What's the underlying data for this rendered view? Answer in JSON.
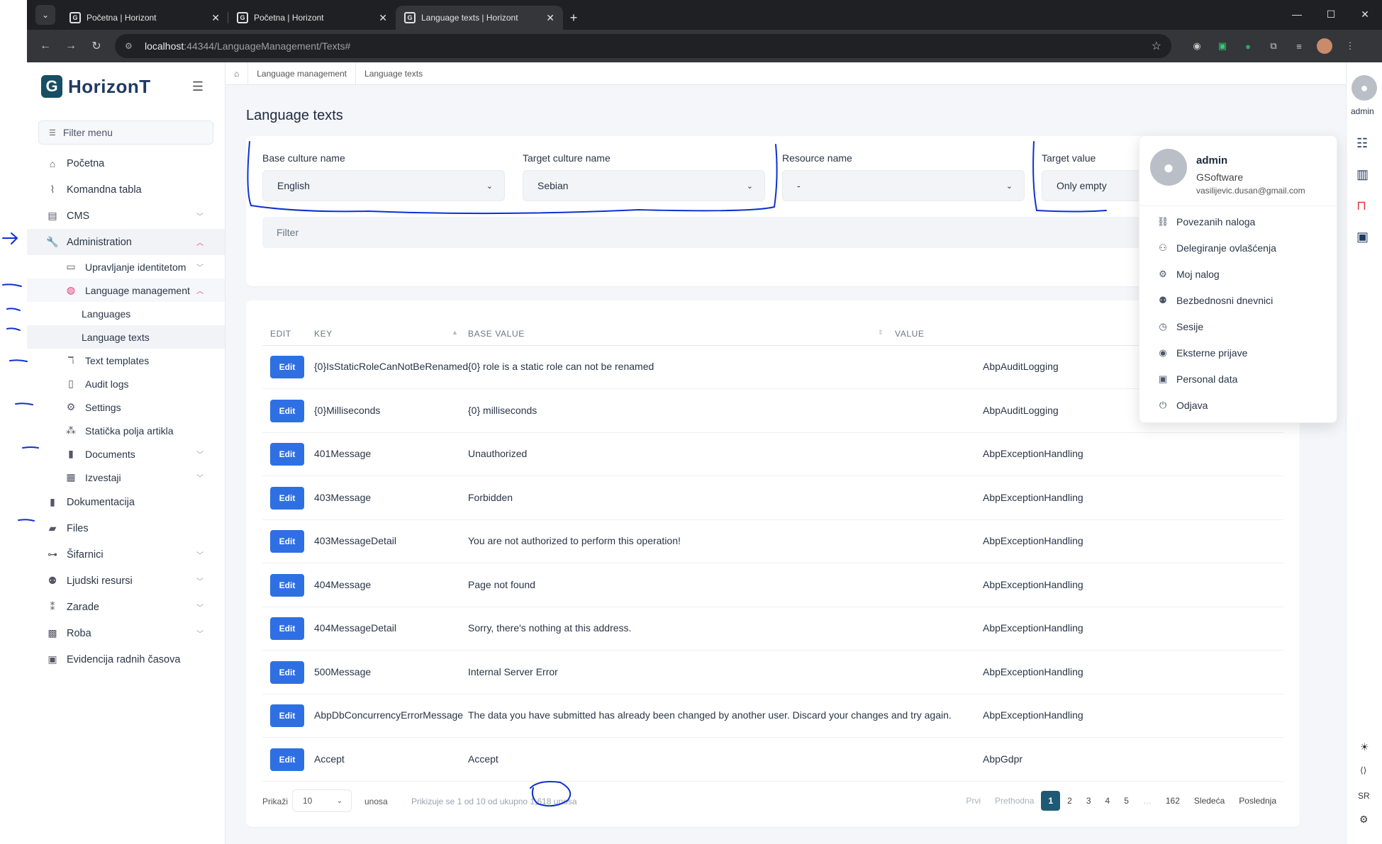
{
  "browser": {
    "tabs": [
      {
        "title": "Početna | Horizont",
        "active": false
      },
      {
        "title": "Početna | Horizont",
        "active": false
      },
      {
        "title": "Language texts | Horizont",
        "active": true
      }
    ],
    "url_host": "localhost",
    "url_path": ":44344/LanguageManagement/Texts#"
  },
  "app": {
    "logo_text": "HorizonT",
    "filter_menu_placeholder": "Filter menu"
  },
  "sidebar": {
    "items": [
      {
        "label": "Početna",
        "icon": "home-icon"
      },
      {
        "label": "Komandna tabla",
        "icon": "chart-line-icon"
      },
      {
        "label": "CMS",
        "icon": "newspaper-icon"
      },
      {
        "label": "Administration",
        "icon": "wrench-icon"
      },
      {
        "label": "Upravljanje identitetom",
        "icon": "id-card-icon"
      },
      {
        "label": "Language management",
        "icon": "globe-icon"
      },
      {
        "label": "Languages"
      },
      {
        "label": "Language texts"
      },
      {
        "label": "Text templates",
        "icon": "text-icon"
      },
      {
        "label": "Audit logs",
        "icon": "file-icon"
      },
      {
        "label": "Settings",
        "icon": "gear-icon"
      },
      {
        "label": "Statička polja artikla",
        "icon": "boxes-icon"
      },
      {
        "label": "Documents",
        "icon": "book-icon"
      },
      {
        "label": "Izvestaji",
        "icon": "report-icon"
      },
      {
        "label": "Dokumentacija",
        "icon": "book-bookmark-icon"
      },
      {
        "label": "Files",
        "icon": "folder-icon"
      },
      {
        "label": "Šifarnici",
        "icon": "sitemap-icon"
      },
      {
        "label": "Ljudski resursi",
        "icon": "people-icon"
      },
      {
        "label": "Zarade",
        "icon": "money-icon"
      },
      {
        "label": "Roba",
        "icon": "boxes-stacked-icon"
      },
      {
        "label": "Evidencija radnih časova",
        "icon": "calendar-icon"
      }
    ]
  },
  "breadcrumb": [
    "Language management",
    "Language texts"
  ],
  "page": {
    "title": "Language texts"
  },
  "filters": {
    "base_culture_label": "Base culture name",
    "base_culture_value": "English",
    "target_culture_label": "Target culture name",
    "target_culture_value": "Sebian",
    "resource_label": "Resource name",
    "resource_value": "-",
    "target_value_label": "Target value",
    "target_value_value": "Only empty",
    "filter_placeholder": "Filter"
  },
  "table": {
    "headers": {
      "edit": "EDIT",
      "key": "KEY",
      "base_value": "BASE VALUE",
      "value": "VALUE"
    },
    "edit_label": "Edit",
    "rows": [
      {
        "key": "{0}IsStaticRoleCanNotBeRenamed",
        "base": "{0} role is a static role can not be renamed",
        "resource": "AbpAuditLogging"
      },
      {
        "key": "{0}Milliseconds",
        "base": "{0} milliseconds",
        "resource": "AbpAuditLogging"
      },
      {
        "key": "401Message",
        "base": "Unauthorized",
        "resource": "AbpExceptionHandling"
      },
      {
        "key": "403Message",
        "base": "Forbidden",
        "resource": "AbpExceptionHandling"
      },
      {
        "key": "403MessageDetail",
        "base": "You are not authorized to perform this operation!",
        "resource": "AbpExceptionHandling"
      },
      {
        "key": "404Message",
        "base": "Page not found",
        "resource": "AbpExceptionHandling"
      },
      {
        "key": "404MessageDetail",
        "base": "Sorry, there's nothing at this address.",
        "resource": "AbpExceptionHandling"
      },
      {
        "key": "500Message",
        "base": "Internal Server Error",
        "resource": "AbpExceptionHandling"
      },
      {
        "key": "AbpDbConcurrencyErrorMessage",
        "base": "The data you have submitted has already been changed by another user. Discard your changes and try again.",
        "resource": "AbpExceptionHandling"
      },
      {
        "key": "Accept",
        "base": "Accept",
        "resource": "AbpGdpr"
      }
    ]
  },
  "footer": {
    "show_label": "Prikaži",
    "page_size": "10",
    "entries_label": "unosa",
    "info": "Prikizuje se 1 od 10 od ukupno 1,618 unosa",
    "pager": [
      "Prvi",
      "Prethodna",
      "1",
      "2",
      "3",
      "4",
      "5",
      "…",
      "162",
      "Sledeća",
      "Poslednja"
    ]
  },
  "user_menu": {
    "name": "admin",
    "company": "GSoftware",
    "email": "vasilijevic.dusan@gmail.com",
    "items": [
      {
        "label": "Povezanih naloga",
        "icon": "link-icon"
      },
      {
        "label": "Delegiranje ovlašćenja",
        "icon": "users-icon"
      },
      {
        "label": "Moj nalog",
        "icon": "gear-icon"
      },
      {
        "label": "Bezbednosni dnevnici",
        "icon": "user-lock-icon"
      },
      {
        "label": "Sesije",
        "icon": "clock-icon"
      },
      {
        "label": "Eksterne prijave",
        "icon": "user-circle-icon"
      },
      {
        "label": "Personal data",
        "icon": "lock-icon"
      },
      {
        "label": "Odjava",
        "icon": "power-icon"
      }
    ]
  },
  "rail": {
    "user_label": "admin",
    "lang": "SR"
  },
  "colors": {
    "accent": "#2f6fe4",
    "pager_active": "#1e5a76",
    "active_icon": "#e23670",
    "ink": "#1030d0"
  }
}
